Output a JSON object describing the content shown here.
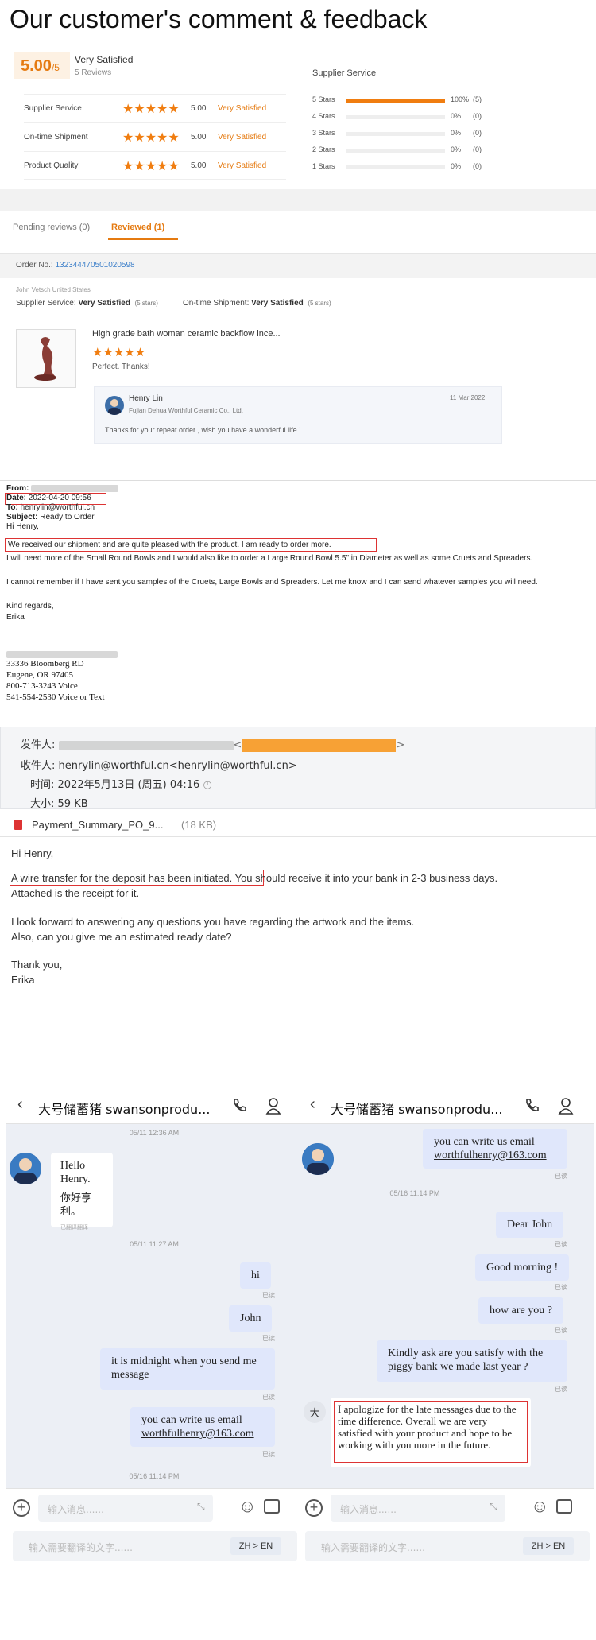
{
  "feedback": {
    "title": "Our customer's comment & feedback",
    "score": "5.00",
    "score_suffix": "/5",
    "summary": "Very Satisfied",
    "reviews_count": "5 Reviews",
    "ratings": [
      {
        "label": "Supplier Service",
        "stars": 5,
        "value": "5.00",
        "text": "Very Satisfied"
      },
      {
        "label": "On-time Shipment",
        "stars": 5,
        "value": "5.00",
        "text": "Very Satisfied"
      },
      {
        "label": "Product Quality",
        "stars": 5,
        "value": "5.00",
        "text": "Very Satisfied"
      }
    ],
    "breakdown_title": "Supplier Service",
    "breakdown": [
      {
        "label": "5 Stars",
        "fraction": 1.0,
        "pct": "100%",
        "count": "(5)"
      },
      {
        "label": "4 Stars",
        "fraction": 0,
        "pct": "0%",
        "count": "(0)"
      },
      {
        "label": "3 Stars",
        "fraction": 0,
        "pct": "0%",
        "count": "(0)"
      },
      {
        "label": "2 Stars",
        "fraction": 0,
        "pct": "0%",
        "count": "(0)"
      },
      {
        "label": "1 Stars",
        "fraction": 0,
        "pct": "0%",
        "count": "(0)"
      }
    ],
    "tabs": {
      "pending": "Pending reviews (0)",
      "reviewed": "Reviewed (1)"
    },
    "order_label": "Order No.:",
    "order_no": "132344470501020598",
    "buyer": "John Vetsch United States",
    "supplier_service_label": "Supplier Service:",
    "supplier_service_value": "Very Satisfied",
    "supplier_service_stars": "(5 stars)",
    "ontime_label": "On-time Shipment:",
    "ontime_value": "Very Satisfied",
    "ontime_stars": "(5 stars)",
    "product_title": "High grade bath woman ceramic backflow ince...",
    "product_comment": "Perfect. Thanks!",
    "reply": {
      "name": "Henry Lin",
      "company": "Fujian Dehua Worthful Ceramic Co., Ltd.",
      "date": "11 Mar 2022",
      "text": "Thanks for your repeat order , wish you have a wonderful life !"
    },
    "star_color": "#f07d10",
    "accent": "#e57a10"
  },
  "email1": {
    "from_label": "From:",
    "date_label": "Date:",
    "date_value": "2022-04-20 09:56",
    "to_label": "To:",
    "to_value": "henrylin@worthful.cn",
    "subject_label": "Subject:",
    "subject_value": "Ready to Order",
    "greeting": "Hi Henry,",
    "line1": "We received our shipment and are quite pleased with the product.  I am ready to order more.",
    "line2": "I will need more of the Small Round Bowls and I would also like to order a Large Round Bowl 5.5\" in Diameter as well as some Cruets and Spreaders.",
    "line3": "I cannot remember if I have sent you samples of the Cruets, Large Bowls and Spreaders.  Let me know and I can send whatever samples you will need.",
    "regards": "Kind regards,",
    "name": "Erika",
    "addr1": "33336 Bloomberg RD",
    "addr2": "Eugene, OR 97405",
    "addr3": "800-713-3243 Voice",
    "addr4": "541-554-2530 Voice or Text"
  },
  "email2": {
    "from_label": "发件人:",
    "to_label": "收件人:",
    "to_value": "henrylin@worthful.cn<henrylin@worthful.cn>",
    "time_label": "时间:",
    "time_value": "2022年5月13日 (周五) 04:16",
    "size_label": "大小:",
    "size_value": "59 KB",
    "attachment": "Payment_Summary_PO_9...",
    "attachment_size": "(18 KB)",
    "greeting": "Hi Henry,",
    "highlight": "A wire transfer for the deposit has been initiated.",
    "line1_rest": " You should receive it into your bank in 2-3 business days.",
    "line2": "Attached is the receipt for it.",
    "line3": "I look forward to answering any questions you have regarding the artwork and the items.",
    "line4": "Also, can you give me an estimated ready date?",
    "thanks": "Thank you,",
    "name": "Erika"
  },
  "chat_left": {
    "title": "大号储蓄猪 swansonprodu...",
    "ts1": "05/11 12:36 AM",
    "msg_hello": "Hello Henry.",
    "msg_hello_cn": "你好亨利。",
    "translated_note": "已翻译翻译",
    "ts2": "05/11 11:27 AM",
    "msg_hi": "hi",
    "msg_john": "John",
    "msg_midnight": "it is midnight when you send me message",
    "msg_email1": "you can write us email",
    "msg_email2": "worthfulhenry@163.com",
    "read": "已读",
    "ts3": "05/16 11:14 PM",
    "input_placeholder": "输入消息......",
    "translate_placeholder": "输入需要翻译的文字......",
    "lang": "ZH > EN"
  },
  "chat_right": {
    "title": "大号储蓄猪 swansonprodu...",
    "msg_email1": "you can write us email",
    "msg_email2": "worthfulhenry@163.com",
    "ts1": "05/16 11:14 PM",
    "msg_dear": "Dear John",
    "msg_morning": "Good morning !",
    "msg_how": "how are you ?",
    "msg_kindly": "Kindly ask  are you satisfy with the piggy bank we made last year ?",
    "avatar_char": "大",
    "msg_apology": "I apologize for the late messages due to the time difference. Overall we are very satisfied with your product and hope to be working with you more in the future.",
    "read": "已读",
    "input_placeholder": "输入消息......",
    "translate_placeholder": "输入需要翻译的文字......",
    "lang": "ZH > EN"
  }
}
